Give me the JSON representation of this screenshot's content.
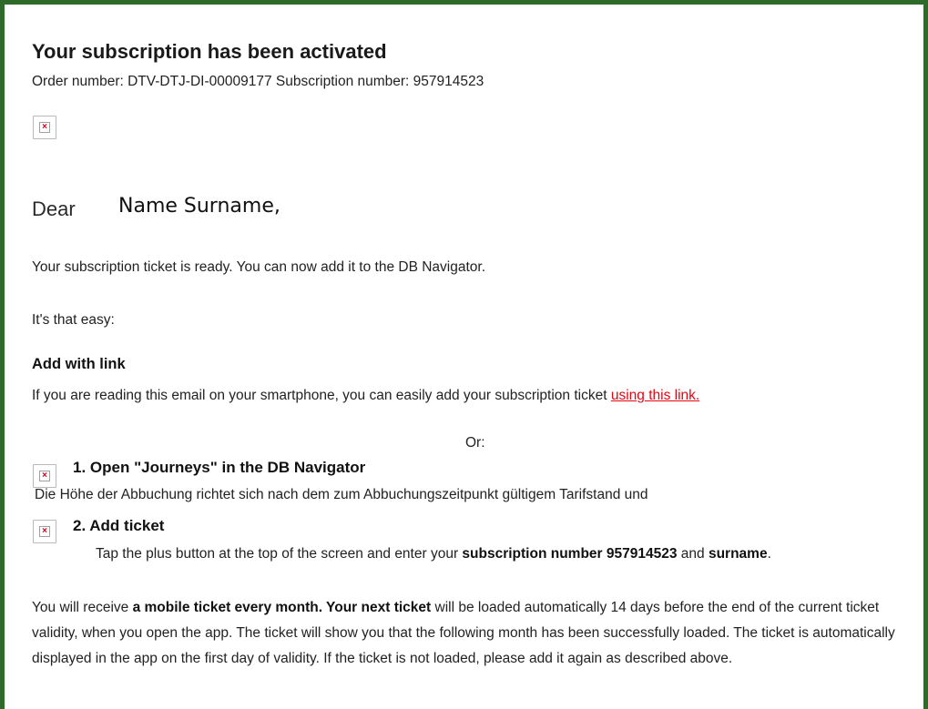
{
  "email": {
    "title": "Your subscription has been activated",
    "order_line": "Order number: DTV-DTJ-DI-00009177 Subscription number: 957914523",
    "greeting_word": "Dear",
    "greeting_name": "Name Surname,",
    "ready_text": "Your subscription ticket is ready. You can now add it to the DB Navigator.",
    "easy_text": "It's that easy:",
    "add_heading": "Add with link",
    "link_text_before": "If you are reading this email on your smartphone, you can easily add your subscription ticket ",
    "link_label": "using this link.",
    "or_text": "Or:",
    "step1_title": "1. Open \"Journeys\" in the DB Navigator",
    "step1_overlay_german": "Die Höhe der Abbuchung richtet sich nach dem zum Abbuchungszeitpunkt gültigem Tarifstand und",
    "step2_title": "2. Add ticket",
    "tap_before": "Tap the plus button at the top of the screen and enter your ",
    "tap_bold1": "subscription number 957914523",
    "tap_mid": " and ",
    "tap_bold2": "surname",
    "tap_end": ".",
    "para_1": "You will receive ",
    "para_bold1": "a mobile ticket every month. Your next ticket",
    "para_2": " will be loaded automatically 14 days before the end of the current ticket validity, when you open the app. The ticket will show you that the following month has been successfully loaded. The ticket is automatically displayed in the app on the first day of validity. If the ticket is not loaded, please add it again as described above."
  },
  "colors": {
    "frame": "#2e6b2b",
    "link": "#e30613"
  },
  "icons": {
    "broken_image": "broken-image-icon"
  }
}
